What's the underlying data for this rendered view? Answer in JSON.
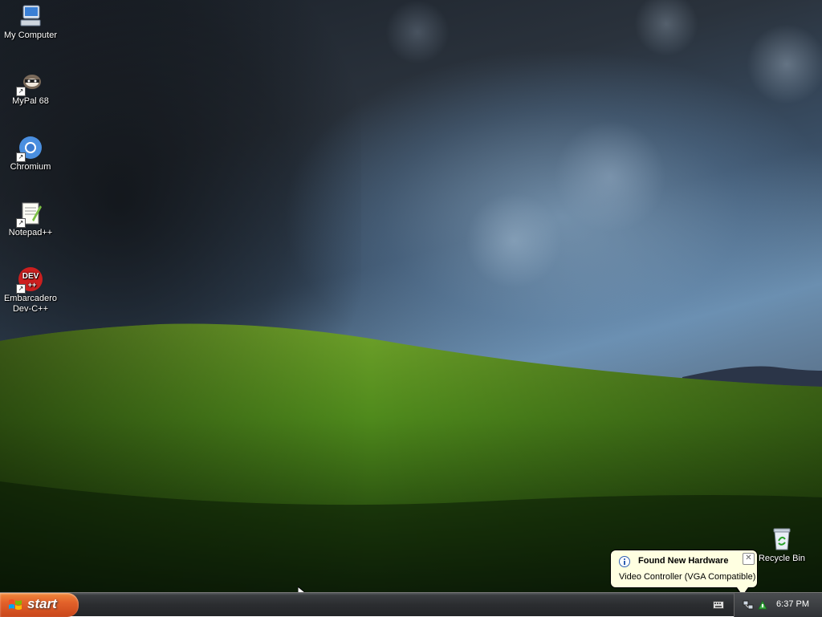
{
  "desktop": {
    "icons": [
      {
        "label": "My Computer",
        "icon": "my-computer-icon"
      },
      {
        "label": "MyPal 68",
        "icon": "mypal-icon"
      },
      {
        "label": "Chromium",
        "icon": "chromium-icon"
      },
      {
        "label": "Notepad++",
        "icon": "notepad-plus-plus-icon"
      },
      {
        "label": "Embarcadero Dev-C++",
        "icon": "dev-cpp-icon",
        "badge": "DEV"
      },
      {
        "label": "Recycle Bin",
        "icon": "recycle-bin-icon"
      }
    ]
  },
  "taskbar": {
    "start_label": "start",
    "clock": "6:37 PM"
  },
  "notification": {
    "title": "Found New Hardware",
    "message": "Video Controller (VGA Compatible)",
    "close_glyph": "✕"
  },
  "colors": {
    "start_button": "#e2612a",
    "balloon_bg": "#ffffe1",
    "hill_green": "#4f8a1c",
    "sky_blue": "#6b8fb0"
  }
}
